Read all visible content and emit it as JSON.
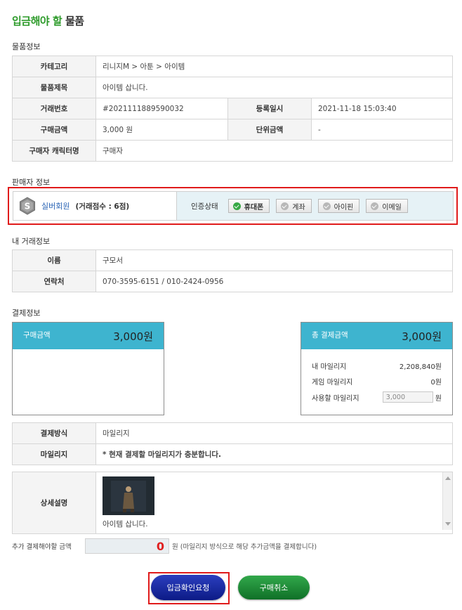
{
  "title": {
    "accent": "입금해야 할",
    "rest": "물품"
  },
  "item_section": {
    "label": "물품정보",
    "category_label": "카테고리",
    "category_value": "리니지M > 아툰 > 아이템",
    "subject_label": "물품제목",
    "subject_value": "아이템 삽니다.",
    "trade_no_label": "거래번호",
    "trade_no_value": "#2021111889590032",
    "reg_date_label": "등록일시",
    "reg_date_value": "2021-11-18 15:03:40",
    "price_label": "구매금액",
    "price_value": "3,000 원",
    "unit_price_label": "단위금액",
    "unit_price_value": "-",
    "buyer_char_label": "구매자 캐릭터명",
    "buyer_char_value": "구매자"
  },
  "seller_section": {
    "label": "판매자 정보",
    "badge_letter": "S",
    "grade": "실버회원",
    "score": "(거래점수 : 6점)",
    "cert_label": "인증상태",
    "certs": [
      {
        "label": "휴대폰",
        "verified": true
      },
      {
        "label": "계좌",
        "verified": false
      },
      {
        "label": "아이핀",
        "verified": false
      },
      {
        "label": "이메일",
        "verified": false
      }
    ]
  },
  "my_trade_section": {
    "label": "내 거래정보",
    "name_label": "이름",
    "name_value": "구모서",
    "contact_label": "연락처",
    "contact_value": "070-3595-6151 / 010-2424-0956"
  },
  "payment_section": {
    "label": "결제정보",
    "purchase_label": "구매금액",
    "purchase_amount": "3,000원",
    "total_label": "총 결제금액",
    "total_amount": "3,000원",
    "my_mileage_label": "내 마일리지",
    "my_mileage_value": "2,208,840원",
    "game_mileage_label": "게임 마일리지",
    "game_mileage_value": "0원",
    "use_mileage_label": "사용할 마일리지",
    "use_mileage_value": "3,000",
    "use_mileage_unit": "원",
    "method_label": "결제방식",
    "method_value": "마일리지",
    "mileage_label": "마일리지",
    "mileage_note": "* 현재 결제할 마일리지가 충분합니다.",
    "detail_label": "상세설명",
    "detail_text": "아이템 삽니다."
  },
  "extra": {
    "label": "추가 결제해야할 금액",
    "amount": "0",
    "note": "원 (마일리지 방식으로 해당 추가금액을 결제합니다)"
  },
  "buttons": {
    "confirm": "입금확인요청",
    "cancel": "구매취소"
  },
  "colors": {
    "accent_green": "#2e9b2b",
    "header_cyan": "#3eb4cf",
    "highlight_red": "#e01b1b",
    "confirm_blue": "#1a2ea8",
    "cancel_green": "#1e8a36"
  }
}
